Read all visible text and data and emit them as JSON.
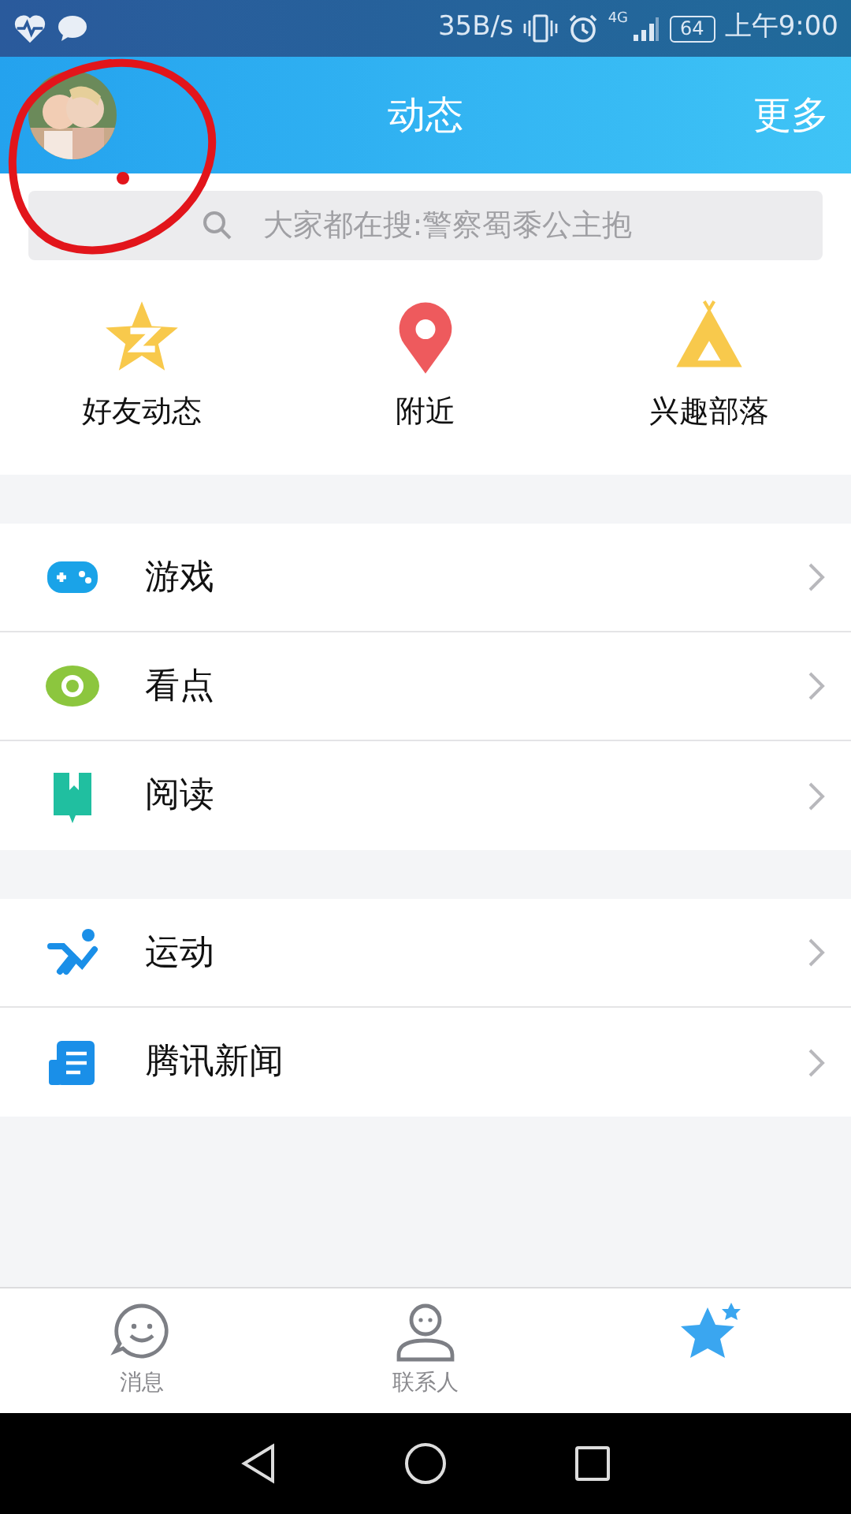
{
  "status_bar": {
    "speed": "35B/s",
    "network": "4G",
    "battery": "64",
    "time": "上午9:00"
  },
  "header": {
    "title": "动态",
    "more": "更多"
  },
  "search": {
    "placeholder": "大家都在搜:警察蜀黍公主抱"
  },
  "shortcuts": [
    {
      "kind": "qzone",
      "label": "好友动态"
    },
    {
      "kind": "nearby",
      "label": "附近"
    },
    {
      "kind": "tribe",
      "label": "兴趣部落"
    }
  ],
  "groups": [
    [
      {
        "kind": "game",
        "label": "游戏"
      },
      {
        "kind": "watch",
        "label": "看点"
      },
      {
        "kind": "read",
        "label": "阅读"
      }
    ],
    [
      {
        "kind": "sport",
        "label": "运动"
      },
      {
        "kind": "news",
        "label": "腾讯新闻"
      }
    ]
  ],
  "tabs": [
    {
      "kind": "messages",
      "label": "消息",
      "selected": false
    },
    {
      "kind": "contacts",
      "label": "联系人",
      "selected": false
    },
    {
      "kind": "feed",
      "selected": true
    }
  ]
}
